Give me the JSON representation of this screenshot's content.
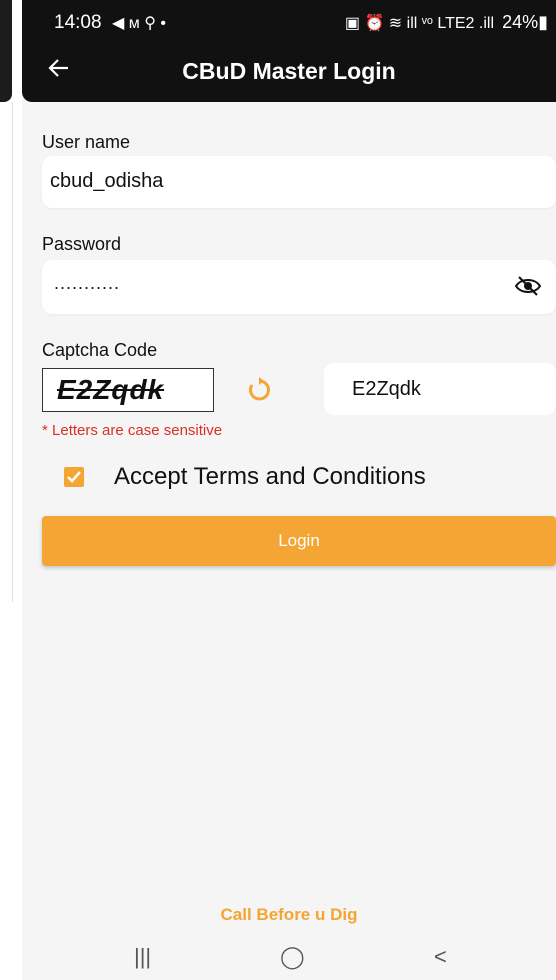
{
  "status_bar": {
    "time": "14:08",
    "left_icons": "◀ ᴍ ⚲ •",
    "right_icons": "▣ ⏰ ≋ ill ᵛᵒ LTE2 .ill",
    "battery": "24%▮"
  },
  "header": {
    "title": "CBuD Master Login",
    "back_icon": "arrow-left-icon"
  },
  "form": {
    "username_label": "User name",
    "username_value": "cbud_odisha",
    "password_label": "Password",
    "password_masked": "...........",
    "captcha_label": "Captcha Code",
    "captcha_image_text": "E2Zqdk",
    "captcha_input_value": "E2Zqdk",
    "captcha_note": "* Letters are case sensitive",
    "terms_label": "Accept Terms and Conditions",
    "terms_checked": true,
    "login_label": "Login"
  },
  "footer": {
    "text": "Call Before u Dig"
  },
  "nav": {
    "recent": "|||",
    "home": "◯",
    "back": "<"
  },
  "colors": {
    "accent": "#f4a533",
    "header": "#111111",
    "error": "#d93025"
  }
}
